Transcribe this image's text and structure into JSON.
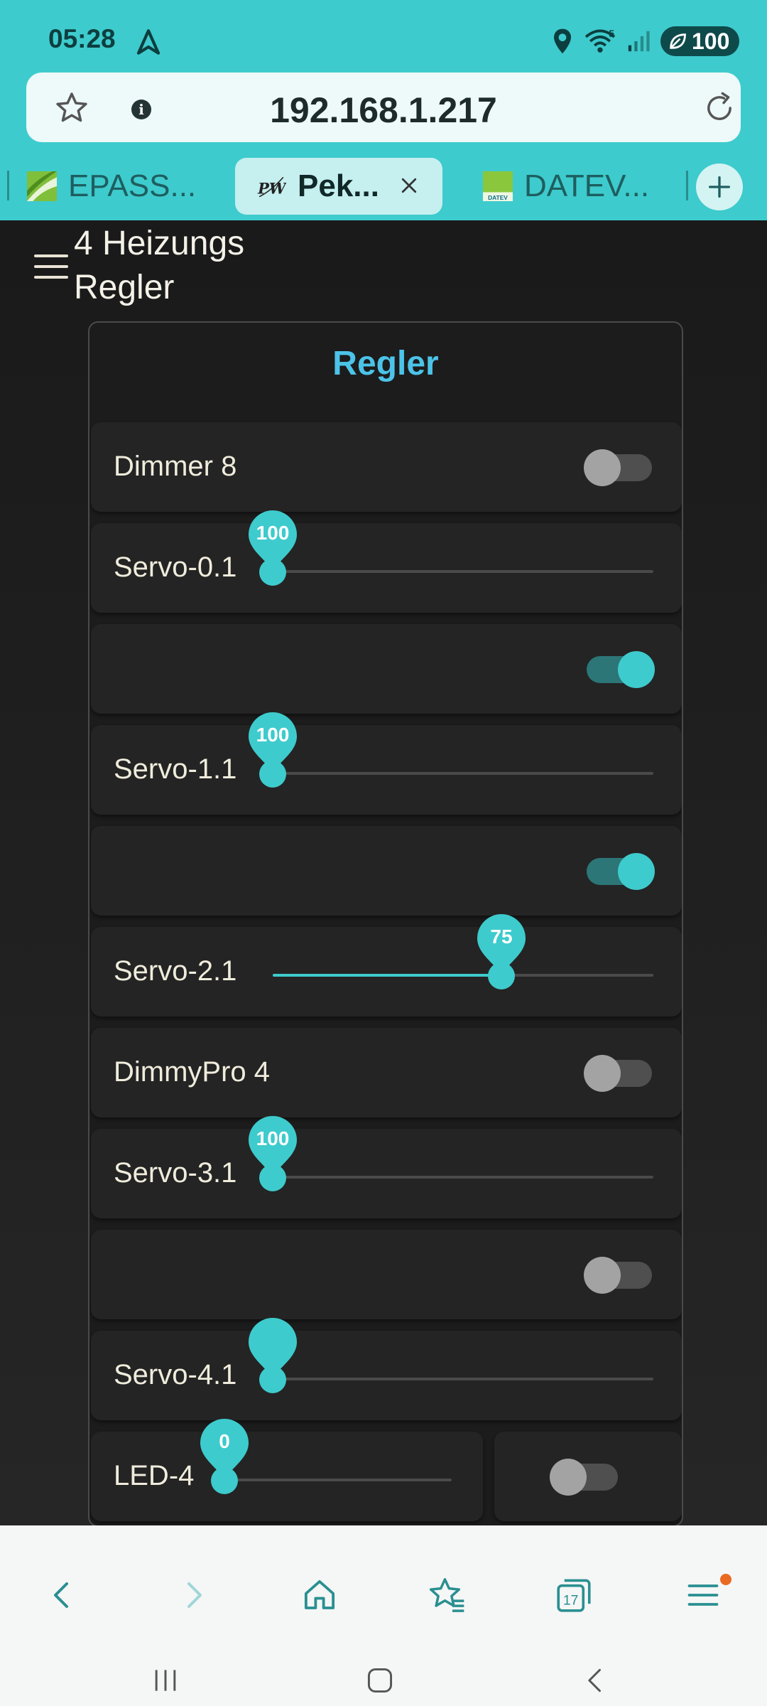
{
  "status_bar": {
    "time": "05:28",
    "battery": "100",
    "network": "5"
  },
  "browser": {
    "url": "192.168.1.217",
    "tabs": [
      {
        "label": "EPASS...",
        "active": false
      },
      {
        "label": "Pek...",
        "active": true
      },
      {
        "label": "DATEV...",
        "active": false
      }
    ],
    "datev_favicon_text": "DATEV"
  },
  "page": {
    "title": "4 Heizungs Regler",
    "card_title": "Regler"
  },
  "controls": {
    "dimmer8": {
      "label": "Dimmer 8",
      "state": "off"
    },
    "servo01": {
      "label": "Servo-0.1",
      "value": "100",
      "fraction": 0.0
    },
    "toggle2": {
      "label": "",
      "state": "on"
    },
    "servo11": {
      "label": "Servo-1.1",
      "value": "100",
      "fraction": 0.0
    },
    "toggle4": {
      "label": "",
      "state": "on"
    },
    "servo21": {
      "label": "Servo-2.1",
      "value": "75",
      "fraction": 0.6
    },
    "dimmypro4": {
      "label": "DimmyPro 4",
      "state": "off"
    },
    "servo31": {
      "label": "Servo-3.1",
      "value": "100",
      "fraction": 0.0
    },
    "toggle8": {
      "label": "",
      "state": "off"
    },
    "servo41": {
      "label": "Servo-4.1",
      "value": "",
      "fraction": 0.0
    },
    "led4": {
      "label": "LED-4",
      "value": "0",
      "fraction": 0.0,
      "toggle_state": "off"
    }
  },
  "colors": {
    "chrome": "#3ecbcd",
    "accent": "#3ecbcd",
    "title_blue": "#4cc3e8",
    "page_bg": "#202020"
  },
  "icons": {
    "navigation": [
      "back-icon",
      "forward-icon",
      "home-icon",
      "bookmarks-icon",
      "tabs-icon",
      "menu-icon"
    ],
    "tabs_count": "17"
  }
}
